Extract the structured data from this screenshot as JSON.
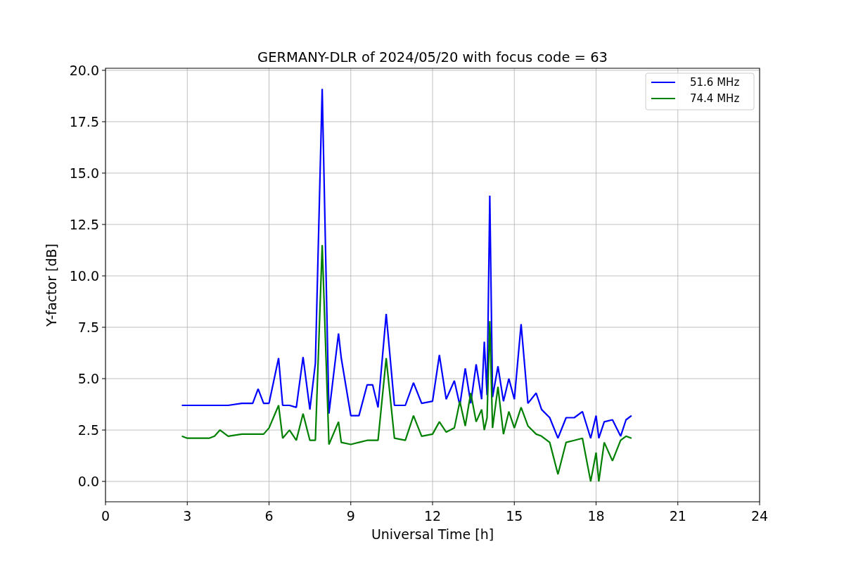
{
  "figure": {
    "chart_data": {
      "type": "line",
      "title": "GERMANY-DLR of 2024/05/20 with focus code = 63",
      "xlabel": "Universal Time [h]",
      "ylabel": "Y-factor [dB]",
      "grid": true,
      "legend": true,
      "xlim": [
        0,
        24
      ],
      "ylim": [
        -0.99,
        20.1
      ],
      "xticks": [
        0,
        3,
        6,
        9,
        12,
        15,
        18,
        21,
        24
      ],
      "yticks": [
        {
          "value": 0,
          "label": "0.0"
        },
        {
          "value": 2.5,
          "label": "2.5"
        },
        {
          "value": 5,
          "label": "5.0"
        },
        {
          "value": 7.5,
          "label": "7.5"
        },
        {
          "value": 10,
          "label": "10.0"
        },
        {
          "value": 12.5,
          "label": "12.5"
        },
        {
          "value": 15,
          "label": "15.0"
        },
        {
          "value": 17.5,
          "label": "17.5"
        },
        {
          "value": 20,
          "label": "20.0"
        }
      ],
      "x": [
        2.8,
        3.0,
        3.5,
        3.8,
        4.0,
        4.2,
        4.5,
        5.0,
        5.4,
        5.6,
        5.8,
        6.0,
        6.35,
        6.5,
        6.75,
        7.0,
        7.25,
        7.5,
        7.7,
        7.95,
        8.2,
        8.55,
        8.65,
        9.0,
        9.3,
        9.6,
        9.8,
        10.0,
        10.3,
        10.6,
        11.0,
        11.3,
        11.6,
        12.0,
        12.25,
        12.5,
        12.8,
        13.0,
        13.2,
        13.4,
        13.6,
        13.8,
        13.9,
        14.0,
        14.1,
        14.2,
        14.4,
        14.6,
        14.8,
        15.0,
        15.25,
        15.5,
        15.8,
        16.0,
        16.3,
        16.6,
        16.9,
        17.2,
        17.5,
        17.8,
        18.0,
        18.1,
        18.3,
        18.6,
        18.9,
        19.1,
        19.3
      ],
      "series": [
        {
          "name": "51.6 MHz",
          "color": "#0000ff",
          "values": [
            3.7,
            3.7,
            3.7,
            3.7,
            3.7,
            3.7,
            3.7,
            3.8,
            3.8,
            4.5,
            3.8,
            3.8,
            6.0,
            3.7,
            3.7,
            3.6,
            6.05,
            3.5,
            5.75,
            19.1,
            3.3,
            7.2,
            6.0,
            3.2,
            3.2,
            4.7,
            4.7,
            3.6,
            8.15,
            3.7,
            3.7,
            4.8,
            3.8,
            3.9,
            6.15,
            4.0,
            4.9,
            3.7,
            5.5,
            3.8,
            5.7,
            4.0,
            6.8,
            4.2,
            13.9,
            4.1,
            5.6,
            3.9,
            5.0,
            4.0,
            7.65,
            3.8,
            4.3,
            3.5,
            3.1,
            2.1,
            3.1,
            3.1,
            3.4,
            2.1,
            3.2,
            2.1,
            2.9,
            3.0,
            2.2,
            3.0,
            3.2
          ]
        },
        {
          "name": "74.4 MHz",
          "color": "#008000",
          "values": [
            2.2,
            2.1,
            2.1,
            2.1,
            2.2,
            2.5,
            2.2,
            2.3,
            2.3,
            2.3,
            2.3,
            2.6,
            3.7,
            2.1,
            2.5,
            2.0,
            3.3,
            2.0,
            2.0,
            11.5,
            1.8,
            2.9,
            1.9,
            1.8,
            1.9,
            2.0,
            2.0,
            2.0,
            6.0,
            2.1,
            2.0,
            3.2,
            2.2,
            2.3,
            2.9,
            2.4,
            2.6,
            3.9,
            2.7,
            4.3,
            2.9,
            3.5,
            2.5,
            3.1,
            7.8,
            2.6,
            4.6,
            2.3,
            3.4,
            2.6,
            3.6,
            2.7,
            2.3,
            2.2,
            1.9,
            0.35,
            1.9,
            2.0,
            2.1,
            0.0,
            1.4,
            0.0,
            1.9,
            1.0,
            2.0,
            2.2,
            2.1
          ]
        }
      ]
    }
  }
}
